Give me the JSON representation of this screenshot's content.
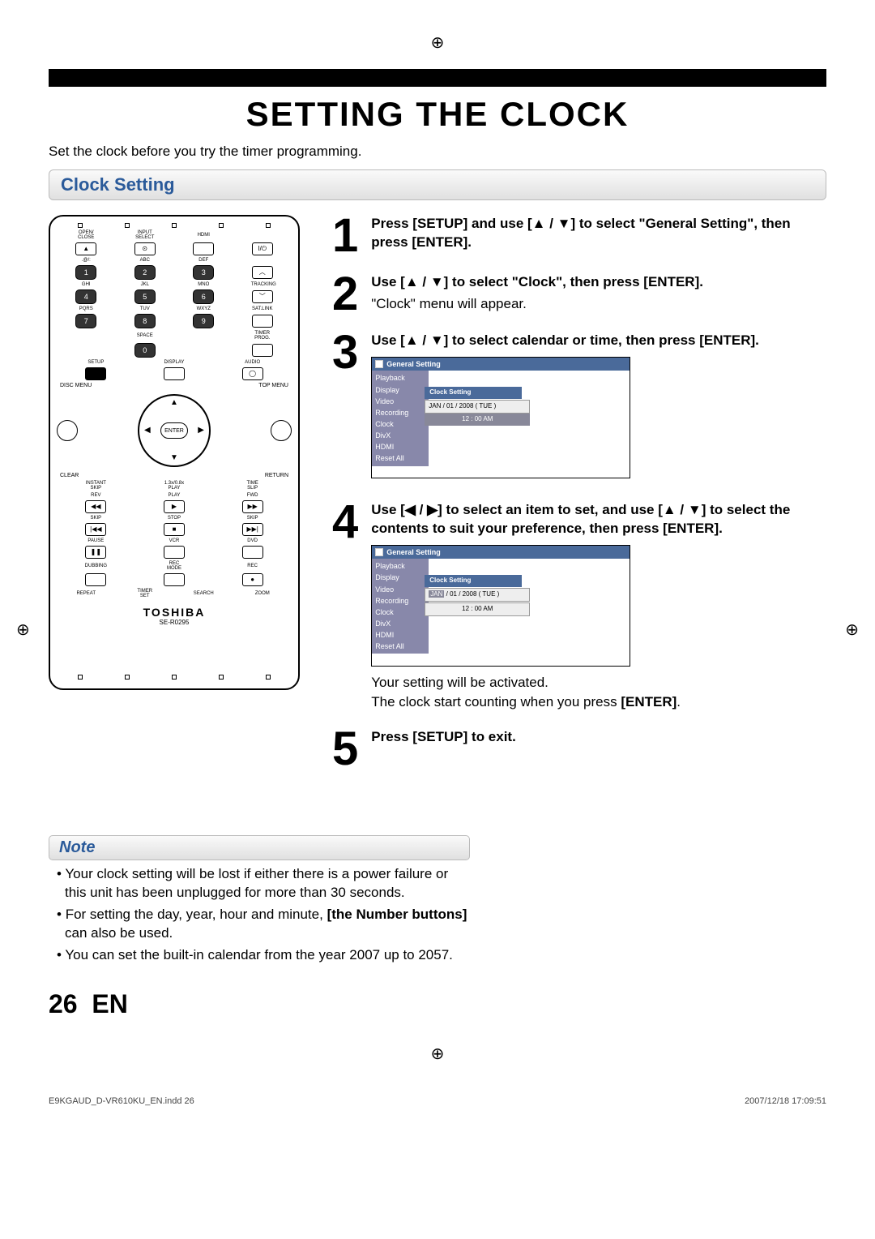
{
  "page_title": "SETTING THE CLOCK",
  "intro_text": "Set the clock before you try the timer programming.",
  "section_heading": "Clock Setting",
  "remote": {
    "row1": [
      "OPEN/\nCLOSE",
      "INPUT\nSELECT",
      "HDMI",
      ""
    ],
    "numpad_labels": [
      ".@/:",
      "ABC",
      "DEF",
      "GHI",
      "JKL",
      "MNO",
      "PQRS",
      "TUV",
      "WXYZ",
      "SPACE"
    ],
    "numbers": [
      "1",
      "2",
      "3",
      "4",
      "5",
      "6",
      "7",
      "8",
      "9",
      "0"
    ],
    "side_labels": [
      "TRACKING",
      "SAT.LINK",
      "TIMER\nPROG."
    ],
    "setup": "SETUP",
    "display": "DISPLAY",
    "audio": "AUDIO",
    "disc_menu": "DISC MENU",
    "top_menu": "TOP MENU",
    "enter": "ENTER",
    "clear": "CLEAR",
    "return": "RETURN",
    "transport_row1": [
      "INSTANT\nSKIP",
      "1.3x/0.8x\nPLAY",
      "TIME SLIP"
    ],
    "transport_labels": [
      "REV",
      "PLAY",
      "FWD",
      "SKIP",
      "STOP",
      "SKIP",
      "PAUSE",
      "VCR",
      "DVD",
      "DUBBING",
      "REC MODE",
      "REC",
      "REPEAT",
      "TIMER SET",
      "SEARCH",
      "ZOOM"
    ],
    "brand": "TOSHIBA",
    "model": "SE-R0295"
  },
  "steps": [
    {
      "num": "1",
      "body_html": "Press [SETUP] and use [▲ / ▼] to select \"General Setting\", then press [ENTER]."
    },
    {
      "num": "2",
      "body_html": "Use [▲ / ▼] to select \"Clock\", then press [ENTER].",
      "sub": "\"Clock\" menu will appear."
    },
    {
      "num": "3",
      "body_html": "Use [▲ / ▼] to select calendar or time, then press [ENTER].",
      "osd": {
        "title": "General Setting",
        "menu": [
          "Playback",
          "Display",
          "Video",
          "Recording",
          "Clock",
          "DivX",
          "HDMI",
          "Reset All"
        ],
        "sub_title": "Clock Setting",
        "date_row": "JAN / 01 / 2008 ( TUE )",
        "time_row": "12 : 00 AM"
      }
    },
    {
      "num": "4",
      "body_html": "Use [◀ / ▶] to select an item to set, and use [▲ / ▼] to select the contents to suit your preference, then press [ENTER].",
      "osd": {
        "title": "General Setting",
        "menu": [
          "Playback",
          "Display",
          "Video",
          "Recording",
          "Clock",
          "DivX",
          "HDMI",
          "Reset All"
        ],
        "sub_title": "Clock Setting",
        "date_row_seg": [
          "JAN",
          " / ",
          "01",
          " / ",
          "2008",
          " ( ",
          "TUE",
          " )"
        ],
        "highlight_index": 0,
        "time_row": "12 : 00 AM"
      },
      "after": [
        "Your setting will be activated.",
        "The clock start counting when you press"
      ],
      "after_bold": "[ENTER]"
    },
    {
      "num": "5",
      "body_html": "Press [SETUP] to exit."
    }
  ],
  "note": {
    "title": "Note",
    "items": [
      {
        "text": "Your clock setting will be lost if either there is a power failure or this unit has been unplugged for more than 30 seconds."
      },
      {
        "text_pre": "For setting the day, year, hour and minute, ",
        "bold": "[the Number buttons]",
        "text_post": " can also be used."
      },
      {
        "text": "You can set the built-in calendar from the year 2007 up to 2057."
      }
    ]
  },
  "page_number": "26",
  "page_lang": "EN",
  "footer_left": "E9KGAUD_D-VR610KU_EN.indd   26",
  "footer_right": "2007/12/18   17:09:51"
}
